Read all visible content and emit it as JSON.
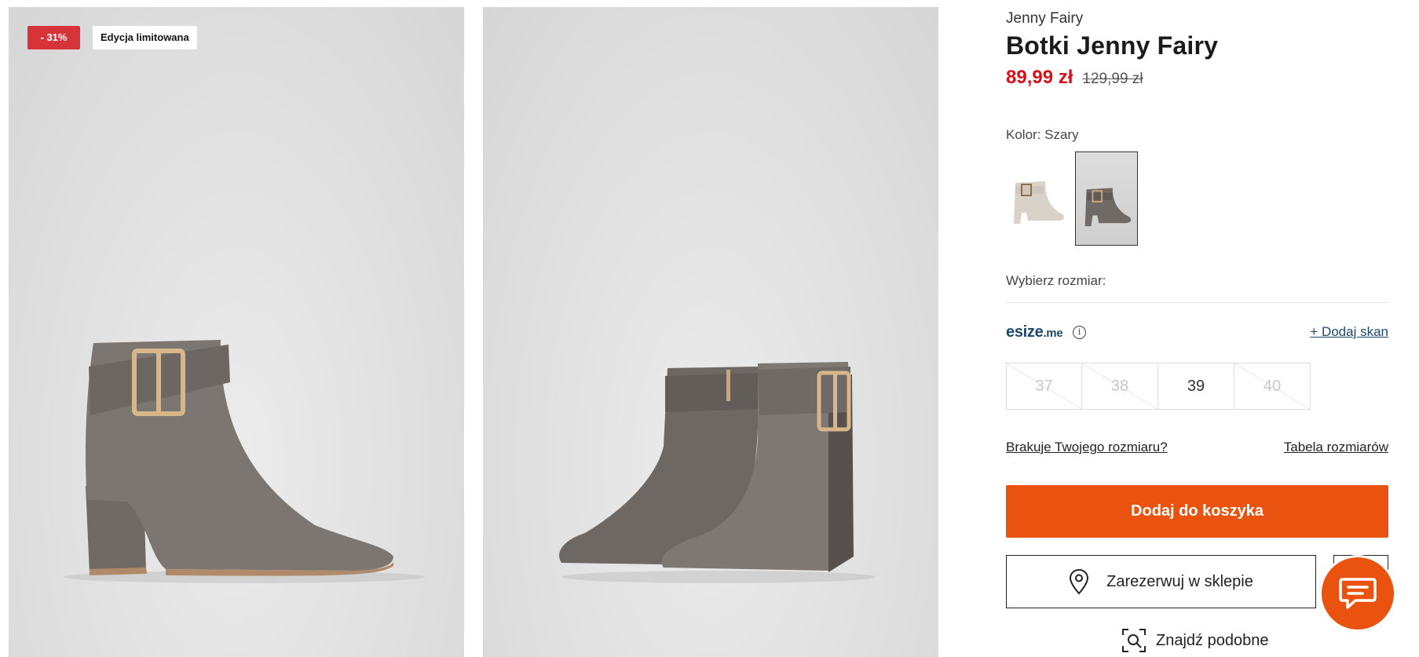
{
  "badges": {
    "discount": "- 31%",
    "limited": "Edycja limitowana"
  },
  "product": {
    "brand": "Jenny Fairy",
    "title": "Botki Jenny Fairy",
    "price_new": "89,99 zł",
    "price_old": "129,99 zł"
  },
  "color": {
    "label": "Kolor: Szary",
    "options": [
      "beżowy",
      "szary"
    ],
    "selected": "szary"
  },
  "size": {
    "label": "Wybierz rozmiar:",
    "esize_logo": "esize",
    "esize_suffix": ".me",
    "add_scan": "+ Dodaj skan",
    "options": [
      {
        "value": "37",
        "available": false
      },
      {
        "value": "38",
        "available": false
      },
      {
        "value": "39",
        "available": true
      },
      {
        "value": "40",
        "available": false
      }
    ],
    "missing_link": "Brakuje Twojego rozmiaru?",
    "table_link": "Tabela rozmiarów"
  },
  "actions": {
    "add_to_cart": "Dodaj do koszyka",
    "reserve": "Zarezerwuj w sklepie",
    "find_similar": "Znajdź podobne"
  },
  "colors": {
    "accent": "#e9530f",
    "price": "#d5121b",
    "discount_badge": "#d7343a",
    "esize": "#1e4b6b"
  },
  "icons": [
    "info-icon",
    "location-pin-icon",
    "heart-icon",
    "visual-search-icon",
    "chat-icon"
  ]
}
